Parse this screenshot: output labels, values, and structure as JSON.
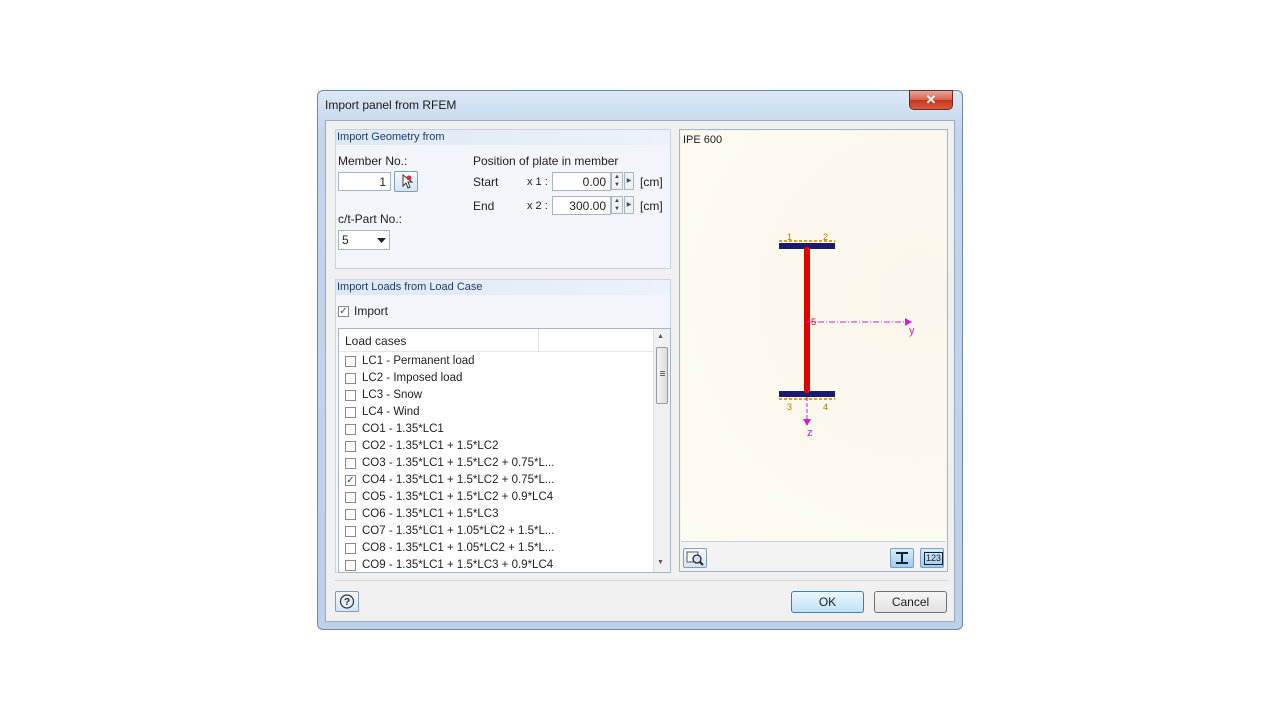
{
  "window": {
    "title": "Import panel from RFEM",
    "close_glyph": "✕"
  },
  "geometry": {
    "heading": "Import Geometry from",
    "member_label": "Member No.:",
    "member_value": "1",
    "position_label": "Position of plate in member",
    "start_label": "Start",
    "end_label": "End",
    "x1_label": "x 1 :",
    "x2_label": "x 2 :",
    "x1_value": "0.00",
    "x2_value": "300.00",
    "unit": "[cm]",
    "ct_label": "c/t-Part No.:",
    "ct_value": "5"
  },
  "loads": {
    "heading": "Import Loads from Load Case",
    "import_label": "Import",
    "import_checked": true,
    "column_header": "Load cases",
    "items": [
      {
        "label": "LC1 - Permanent load",
        "checked": false
      },
      {
        "label": "LC2 - Imposed load",
        "checked": false
      },
      {
        "label": "LC3 - Snow",
        "checked": false
      },
      {
        "label": "LC4 - Wind",
        "checked": false
      },
      {
        "label": "CO1 - 1.35*LC1",
        "checked": false
      },
      {
        "label": "CO2 - 1.35*LC1 + 1.5*LC2",
        "checked": false
      },
      {
        "label": "CO3 - 1.35*LC1 + 1.5*LC2 + 0.75*L...",
        "checked": false
      },
      {
        "label": "CO4 - 1.35*LC1 + 1.5*LC2 + 0.75*L...",
        "checked": true
      },
      {
        "label": "CO5 - 1.35*LC1 + 1.5*LC2 + 0.9*LC4",
        "checked": false
      },
      {
        "label": "CO6 - 1.35*LC1 + 1.5*LC3",
        "checked": false
      },
      {
        "label": "CO7 - 1.35*LC1 + 1.05*LC2 + 1.5*L...",
        "checked": false
      },
      {
        "label": "CO8 - 1.35*LC1 + 1.05*LC2 + 1.5*L...",
        "checked": false
      },
      {
        "label": "CO9 - 1.35*LC1 + 1.5*LC3 + 0.9*LC4",
        "checked": false
      }
    ]
  },
  "preview": {
    "section_name": "IPE 600",
    "points": {
      "p1": "1",
      "p2": "2",
      "p3": "3",
      "p4": "4",
      "p5": "5"
    },
    "axis_y": "y",
    "axis_z": "z",
    "colors": {
      "web": "#e00000",
      "flange": "#1c1c6e",
      "axis": "#d020d0",
      "hatch": "#e0a020"
    }
  },
  "buttons": {
    "ok": "OK",
    "cancel": "Cancel",
    "help_icon": "help-icon",
    "values_icon_text": "123"
  }
}
